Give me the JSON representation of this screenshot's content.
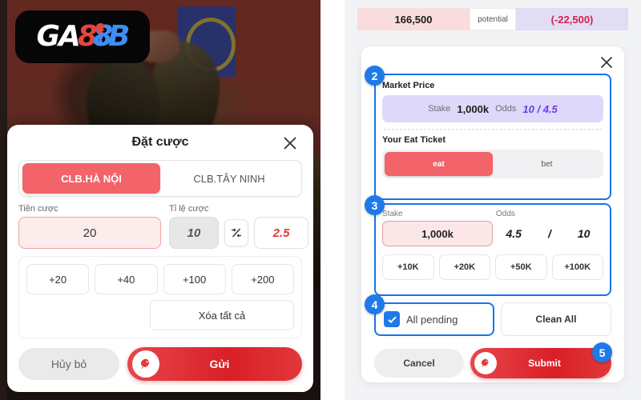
{
  "brand": {
    "logo_ga": "GA",
    "logo_8_red": "8",
    "logo_8_blue": "8",
    "logo_b": "B",
    "logo_icon": "rooster-icon"
  },
  "left_dialog": {
    "title": "Đặt cược",
    "close_icon": "close-icon",
    "teams": [
      {
        "label": "CLB.HÀ NỘI",
        "active": true
      },
      {
        "label": "CLB.TÂY NINH",
        "active": false
      }
    ],
    "stake_label": "Tiền cược",
    "stake_value": "20",
    "odds_label": "Tỉ lệ cược",
    "odds_a": "10",
    "swap_icon": "swap-odds-icon",
    "odds_b": "2.5",
    "quick_amounts": [
      "+20",
      "+40",
      "+100",
      "+200"
    ],
    "clear_all_label": "Xóa tất cả",
    "cancel_label": "Hủy bỏ",
    "submit_label": "Gửi",
    "submit_icon": "rooster-icon"
  },
  "right_panel": {
    "summary": {
      "left_value": "166,500",
      "middle_label": "potential",
      "right_value": "(-22,500)"
    },
    "close_icon": "close-icon",
    "step2": {
      "badge": "2",
      "section_label": "Market Price",
      "stake_key": "Stake",
      "stake_value": "1,000k",
      "odds_key": "Odds",
      "odds_value": "10 / 4.5",
      "ticket_label": "Your Eat Ticket",
      "ticket_options": [
        {
          "label": "eat",
          "active": true
        },
        {
          "label": "bet",
          "active": false
        }
      ]
    },
    "step3": {
      "badge": "3",
      "stake_label": "Stake",
      "odds_label": "Odds",
      "stake_value": "1,000k",
      "odds_left": "4.5",
      "odds_sep": "/",
      "odds_right": "10",
      "quick_amounts": [
        "+10K",
        "+20K",
        "+50K",
        "+100K"
      ]
    },
    "step4": {
      "badge": "4",
      "checkbox_label": "All pending",
      "checkbox_checked": true,
      "check_icon": "check-icon",
      "clean_all_label": "Clean All"
    },
    "step5": {
      "badge": "5",
      "cancel_label": "Cancel",
      "submit_label": "Submit",
      "submit_icon": "rooster-icon"
    }
  },
  "colors": {
    "accent_red": "#f2636a",
    "submit_red": "#d81f26",
    "badge_blue": "#1e7ae8",
    "highlight_blue": "#1a73e8",
    "purple_chip": "#ded8fa",
    "purple_text": "#6a3ee8",
    "summary_pink": "#fadcdc",
    "summary_lavender": "#e2dcf5",
    "negative_red": "#cf2448"
  }
}
